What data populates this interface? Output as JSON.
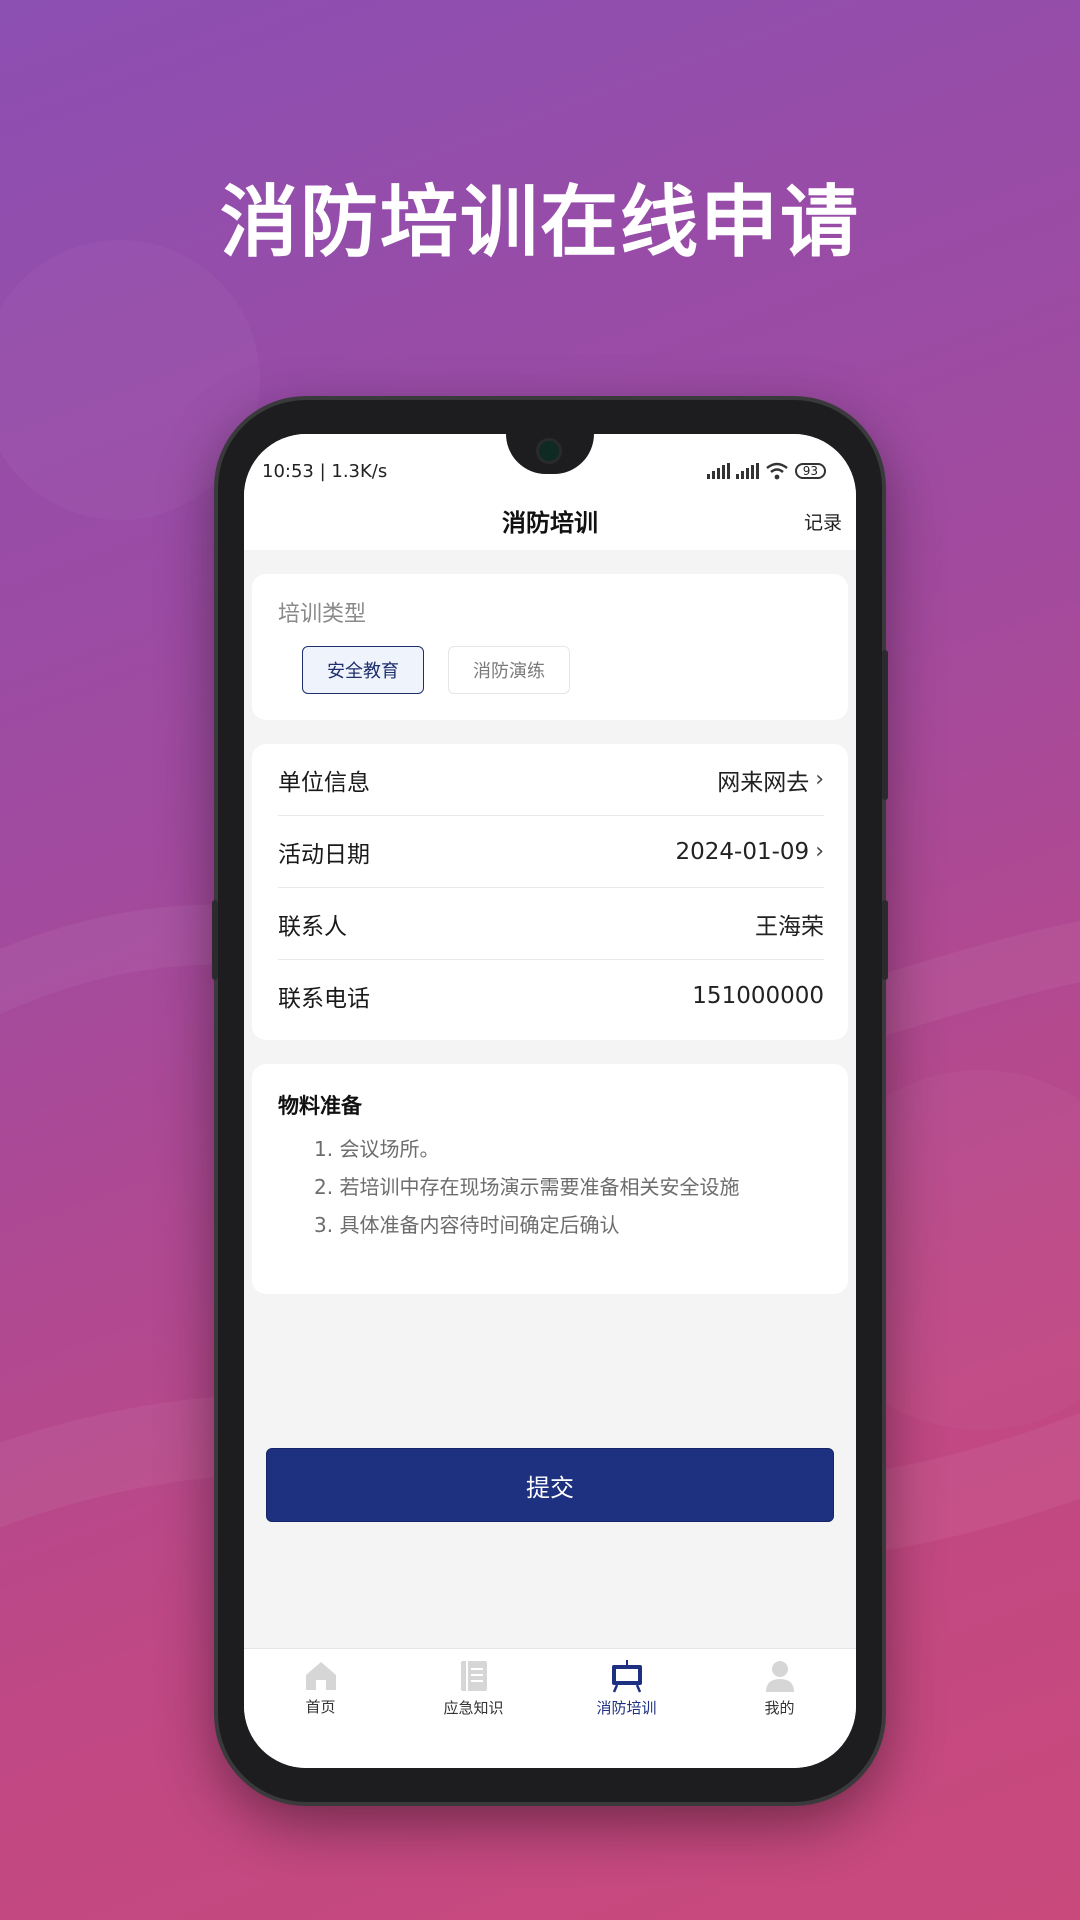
{
  "promo": {
    "headline": "消防培训在线申请"
  },
  "status_bar": {
    "time_speed": "10:53 | 1.3K/s",
    "battery": "93"
  },
  "nav": {
    "title": "消防培训",
    "record_link": "记录"
  },
  "training_type": {
    "label": "培训类型",
    "options": [
      {
        "label": "安全教育",
        "selected": true
      },
      {
        "label": "消防演练",
        "selected": false
      }
    ]
  },
  "info": {
    "rows": [
      {
        "label": "单位信息",
        "value": "网来网去",
        "has_chevron": true
      },
      {
        "label": "活动日期",
        "value": "2024-01-09",
        "has_chevron": true
      },
      {
        "label": "联系人",
        "value": "王海荣",
        "has_chevron": false
      },
      {
        "label": "联系电话",
        "value": "151000000",
        "has_chevron": false
      }
    ]
  },
  "materials": {
    "title": "物料准备",
    "items": [
      "1. 会议场所。",
      "2. 若培训中存在现场演示需要准备相关安全设施",
      "3. 具体准备内容待时间确定后确认"
    ]
  },
  "submit": {
    "label": "提交"
  },
  "tabbar": {
    "tabs": [
      {
        "label": "首页",
        "icon": "home-icon",
        "active": false
      },
      {
        "label": "应急知识",
        "icon": "book-icon",
        "active": false
      },
      {
        "label": "消防培训",
        "icon": "board-icon",
        "active": true
      },
      {
        "label": "我的",
        "icon": "user-icon",
        "active": false
      }
    ]
  },
  "colors": {
    "primary": "#1e3080",
    "inactive_icon": "#d6d6d6"
  }
}
